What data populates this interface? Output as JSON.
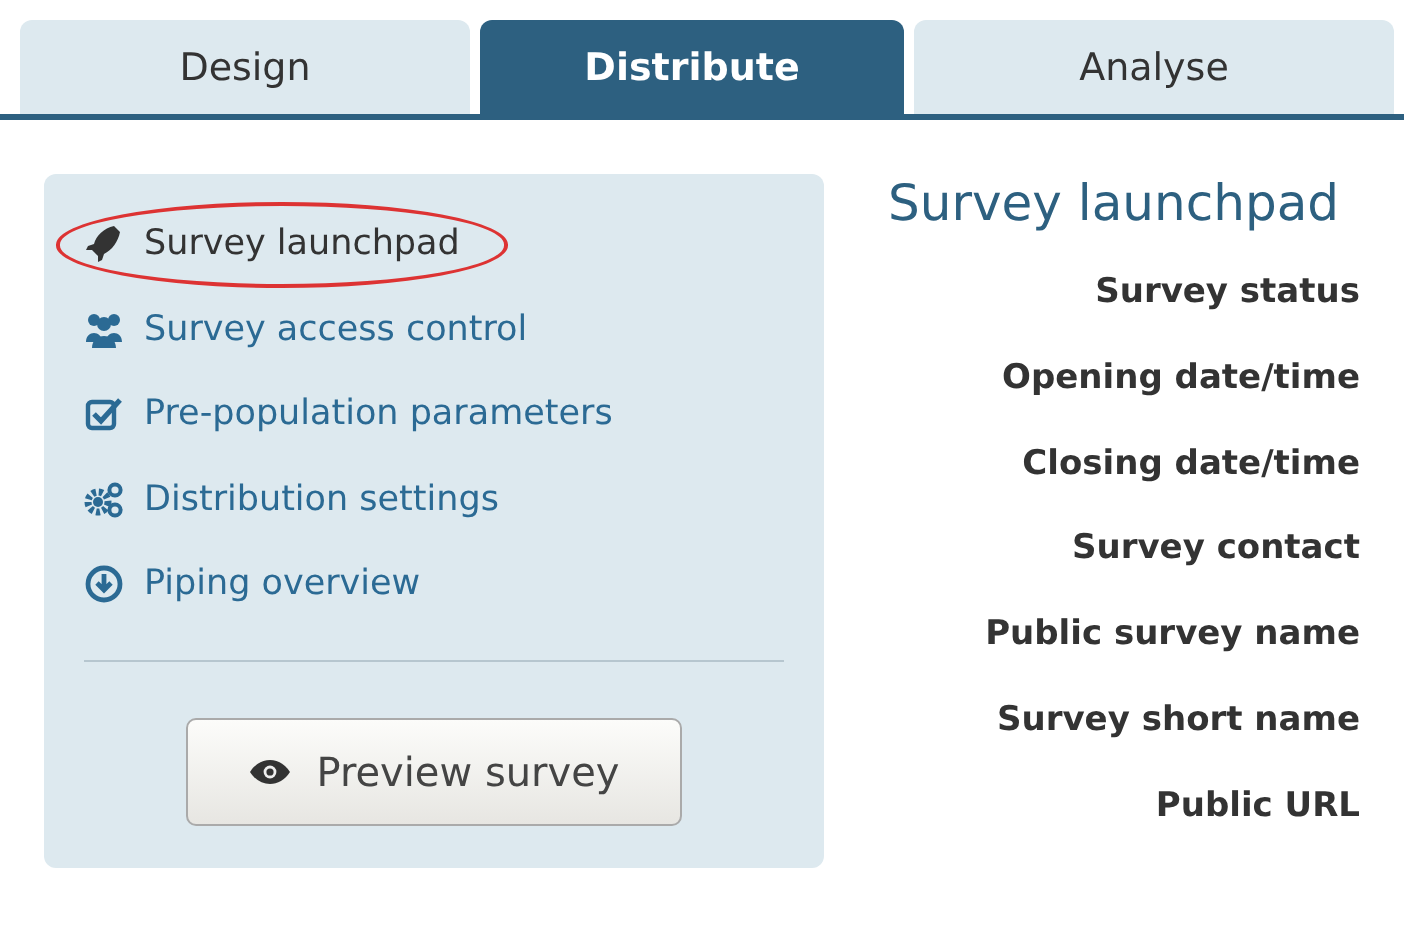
{
  "tabs": [
    {
      "label": "Design",
      "selected": false
    },
    {
      "label": "Distribute",
      "selected": true
    },
    {
      "label": "Analyse",
      "selected": false
    }
  ],
  "sidebar": {
    "items": [
      {
        "label": "Survey launchpad",
        "selected": true
      },
      {
        "label": "Survey access control",
        "selected": false
      },
      {
        "label": "Pre-population parameters",
        "selected": false
      },
      {
        "label": "Distribution settings",
        "selected": false
      },
      {
        "label": "Piping overview",
        "selected": false
      }
    ],
    "button": "Preview survey"
  },
  "content": {
    "title": "Survey launchpad",
    "fields": [
      "Survey status",
      "Opening date/time",
      "Closing date/time",
      "Survey contact",
      "Public survey name",
      "Survey short name",
      "Public URL"
    ]
  }
}
